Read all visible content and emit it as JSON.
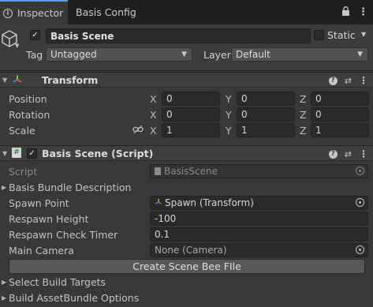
{
  "tabs": [
    {
      "label": "Inspector",
      "icon": "info-icon",
      "active": true
    },
    {
      "label": "Basis Config",
      "active": false
    }
  ],
  "object": {
    "name": "Basis Scene",
    "active": true,
    "static_label": "Static",
    "tag_label": "Tag",
    "tag_value": "Untagged",
    "layer_label": "Layer",
    "layer_value": "Default"
  },
  "transform": {
    "title": "Transform",
    "position_label": "Position",
    "rotation_label": "Rotation",
    "scale_label": "Scale",
    "axis_x": "X",
    "axis_y": "Y",
    "axis_z": "Z",
    "position": {
      "x": "0",
      "y": "0",
      "z": "0"
    },
    "rotation": {
      "x": "0",
      "y": "0",
      "z": "0"
    },
    "scale": {
      "x": "1",
      "y": "1",
      "z": "1"
    }
  },
  "script_component": {
    "title": "Basis Scene (Script)",
    "script_label": "Script",
    "script_value": "BasisScene",
    "bundle_description_label": "Basis Bundle Description",
    "spawn_point_label": "Spawn Point",
    "spawn_point_value": "Spawn (Transform)",
    "respawn_height_label": "Respawn Height",
    "respawn_height_value": "-100",
    "respawn_timer_label": "Respawn Check Timer",
    "respawn_timer_value": "0.1",
    "main_camera_label": "Main Camera",
    "main_camera_value": "None (Camera)",
    "create_button_label": "Create Scene Bee FIle",
    "select_targets_label": "Select Build Targets",
    "build_options_label": "Build AssetBundle Options"
  },
  "colors": {
    "accent": "#4aa3ff",
    "panel": "#383838",
    "field": "#2a2a2a"
  }
}
